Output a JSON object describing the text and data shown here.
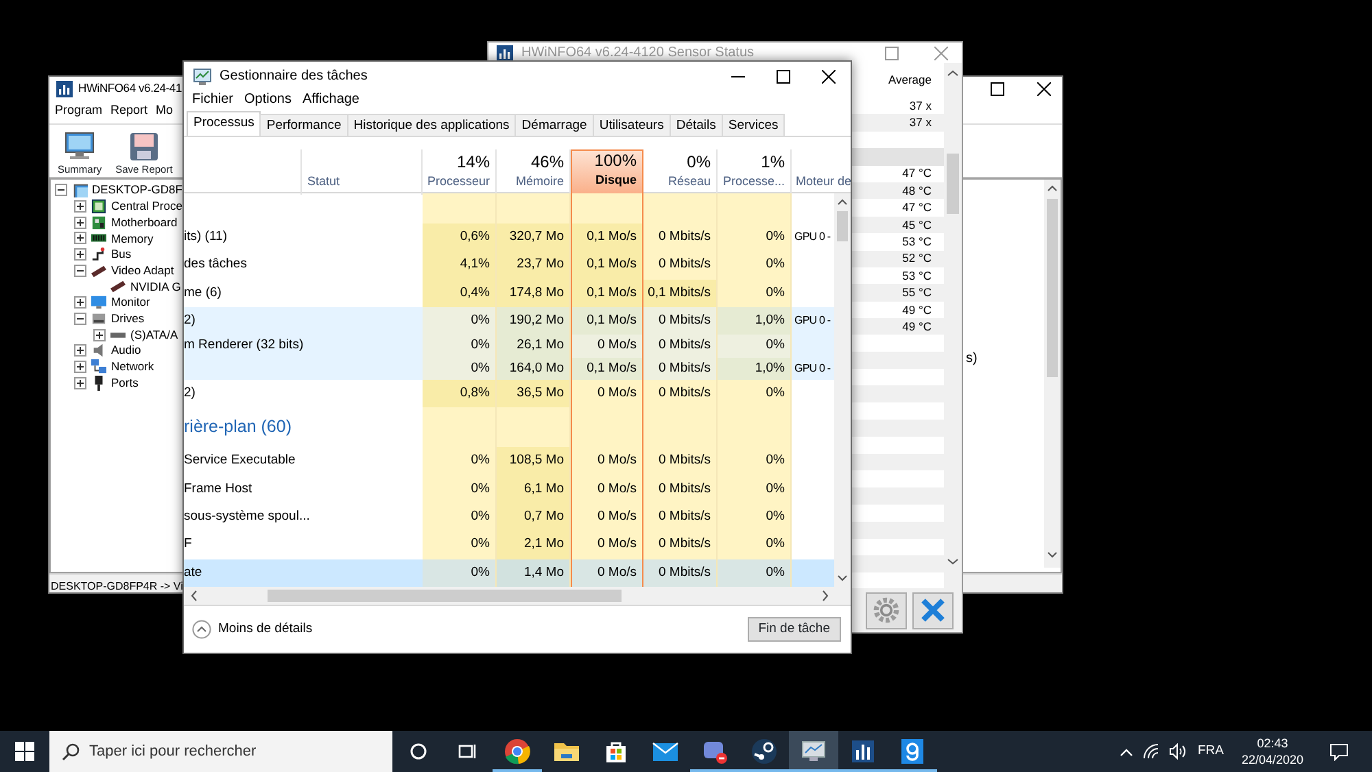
{
  "hwinfo_main": {
    "title": "HWiNFO64 v6.24-41",
    "menu": [
      "Program",
      "Report",
      "Mo"
    ],
    "toolbar": [
      "Summary",
      "Save Report"
    ],
    "tree": [
      {
        "label": "DESKTOP-GD8F",
        "expanded": true,
        "children": [
          {
            "label": "Central Proce",
            "expanded": false
          },
          {
            "label": "Motherboard",
            "expanded": false
          },
          {
            "label": "Memory",
            "expanded": false
          },
          {
            "label": "Bus",
            "expanded": false
          },
          {
            "label": "Video Adapt",
            "expanded": true,
            "children": [
              {
                "label": "NVIDIA G"
              }
            ]
          },
          {
            "label": "Monitor",
            "expanded": false
          },
          {
            "label": "Drives",
            "expanded": true,
            "children": [
              {
                "label": "(S)ATA/A",
                "expanded": false
              }
            ]
          },
          {
            "label": "Audio",
            "expanded": false
          },
          {
            "label": "Network",
            "expanded": false
          },
          {
            "label": "Ports",
            "expanded": false
          }
        ]
      }
    ],
    "side_text": "s)",
    "status_bar": "DESKTOP-GD8FP4R -> Vi"
  },
  "sensor_window": {
    "title": "HWiNFO64 v6.24-4120 Sensor Status",
    "column_heading": "Average",
    "rows": [
      {
        "kind": "value",
        "value": "37 x"
      },
      {
        "kind": "value",
        "value": "37 x"
      },
      {
        "kind": "blank"
      },
      {
        "kind": "band"
      },
      {
        "kind": "value",
        "value": "47 °C"
      },
      {
        "kind": "value",
        "value": "48 °C"
      },
      {
        "kind": "value",
        "value": "47 °C"
      },
      {
        "kind": "value",
        "value": "45 °C"
      },
      {
        "kind": "value",
        "value": "53 °C"
      },
      {
        "kind": "value",
        "value": "52 °C"
      },
      {
        "kind": "value",
        "value": "53 °C"
      },
      {
        "kind": "value",
        "value": "55 °C"
      },
      {
        "kind": "value",
        "value": "49 °C"
      },
      {
        "kind": "value",
        "value": "49 °C"
      }
    ]
  },
  "task_manager": {
    "title": "Gestionnaire des tâches",
    "menu": [
      "Fichier",
      "Options",
      "Affichage"
    ],
    "tabs": [
      {
        "label": "Processus",
        "selected": true
      },
      {
        "label": "Performance",
        "selected": false
      },
      {
        "label": "Historique des applications",
        "selected": false
      },
      {
        "label": "Démarrage",
        "selected": false
      },
      {
        "label": "Utilisateurs",
        "selected": false
      },
      {
        "label": "Détails",
        "selected": false
      },
      {
        "label": "Services",
        "selected": false
      }
    ],
    "status_column": "Statut",
    "columns": [
      {
        "usage": "14%",
        "label": "Processeur",
        "highlighted": false
      },
      {
        "usage": "46%",
        "label": "Mémoire",
        "highlighted": false
      },
      {
        "usage": "100%",
        "label": "Disque",
        "highlighted": true
      },
      {
        "usage": "0%",
        "label": "Réseau",
        "highlighted": false
      },
      {
        "usage": "1%",
        "label": "Processe...",
        "highlighted": false
      }
    ],
    "engine_column": "Moteur de",
    "rows": [
      {
        "kind": "process",
        "name": "its) (11)",
        "cells": [
          "0,6%",
          "320,7 Mo",
          "0,1 Mo/s",
          "0 Mbits/s",
          "0%"
        ],
        "engine": "GPU 0 -",
        "selected": false,
        "hovered": false
      },
      {
        "kind": "process",
        "name": "des tâches",
        "cells": [
          "4,1%",
          "23,7 Mo",
          "0,1 Mo/s",
          "0 Mbits/s",
          "0%"
        ],
        "selected": false,
        "hovered": false
      },
      {
        "kind": "process",
        "name": "me (6)",
        "cells": [
          "0,4%",
          "174,8 Mo",
          "0,1 Mo/s",
          "0,1 Mbits/s",
          "0%"
        ],
        "selected": false,
        "hovered": false
      },
      {
        "kind": "process",
        "name": "2)",
        "cells": [
          "0%",
          "190,2 Mo",
          "0,1 Mo/s",
          "0 Mbits/s",
          "1,0%"
        ],
        "engine": "GPU 0 -",
        "selected": false,
        "hovered": true
      },
      {
        "kind": "child",
        "name": "m Renderer (32 bits)",
        "cells": [
          "0%",
          "26,1 Mo",
          "0 Mo/s",
          "0 Mbits/s",
          "0%"
        ],
        "selected": false,
        "hovered": true
      },
      {
        "kind": "child",
        "cells": [
          "0%",
          "164,0 Mo",
          "0,1 Mo/s",
          "0 Mbits/s",
          "1,0%"
        ],
        "engine": "GPU 0 -",
        "selected": false,
        "hovered": true
      },
      {
        "kind": "process",
        "name": "2)",
        "cells": [
          "0,8%",
          "36,5 Mo",
          "0 Mo/s",
          "0 Mbits/s",
          "0%"
        ],
        "selected": false,
        "hovered": false
      },
      {
        "kind": "group",
        "name": "rière-plan (60)"
      },
      {
        "kind": "process",
        "name": "Service Executable",
        "cells": [
          "0%",
          "108,5 Mo",
          "0 Mo/s",
          "0 Mbits/s",
          "0%"
        ],
        "selected": false,
        "hovered": false
      },
      {
        "kind": "process",
        "name": "Frame Host",
        "cells": [
          "0%",
          "6,1 Mo",
          "0 Mo/s",
          "0 Mbits/s",
          "0%"
        ],
        "selected": false,
        "hovered": false
      },
      {
        "kind": "process",
        "name": "sous-système spoul...",
        "cells": [
          "0%",
          "0,7 Mo",
          "0 Mo/s",
          "0 Mbits/s",
          "0%"
        ],
        "selected": false,
        "hovered": false
      },
      {
        "kind": "process",
        "name": "F",
        "cells": [
          "0%",
          "2,1 Mo",
          "0 Mo/s",
          "0 Mbits/s",
          "0%"
        ],
        "selected": false,
        "hovered": false
      },
      {
        "kind": "process",
        "name": "ate",
        "cells": [
          "0%",
          "1,4 Mo",
          "0 Mo/s",
          "0 Mbits/s",
          "0%"
        ],
        "selected": true,
        "hovered": false
      }
    ],
    "less_details": "Moins de détails",
    "end_task": "Fin de tâche"
  },
  "taskbar": {
    "search": {
      "placeholder": "Taper ici pour rechercher"
    },
    "apps": [
      {
        "running": true,
        "active": false
      },
      {
        "running": false,
        "active": false
      },
      {
        "running": false,
        "active": false
      },
      {
        "running": false,
        "active": false
      },
      {
        "running": true,
        "active": false
      },
      {
        "running": true,
        "active": false
      },
      {
        "running": true,
        "active": true
      },
      {
        "running": true,
        "active": false
      },
      {
        "running": true,
        "active": false
      }
    ],
    "language": "FRA",
    "time": "02:43",
    "date": "22/04/2020"
  }
}
